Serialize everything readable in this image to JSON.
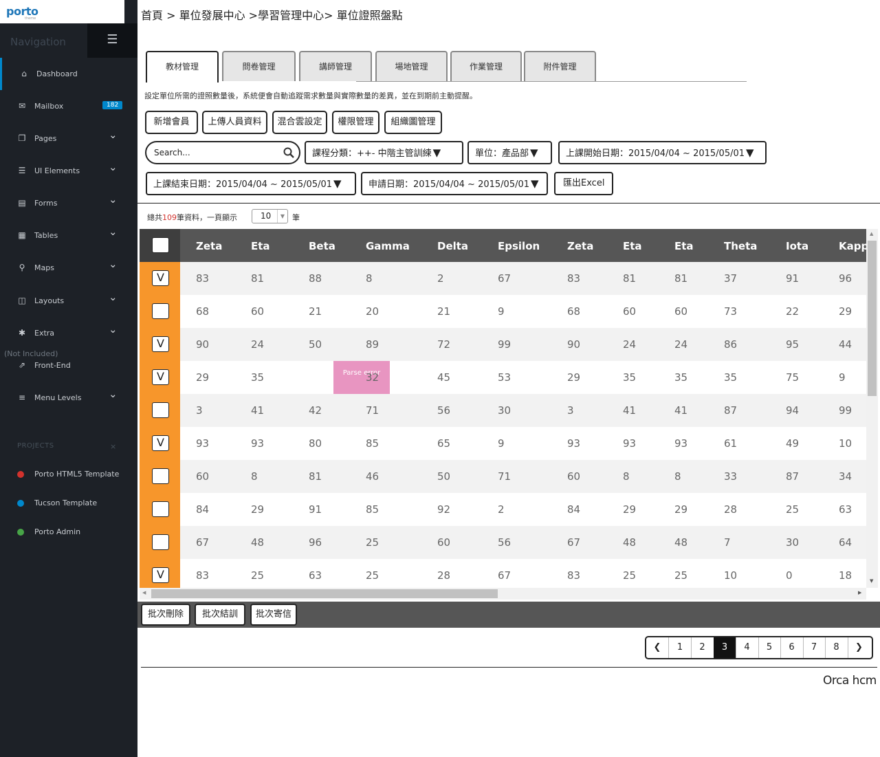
{
  "logo": {
    "text": "porto",
    "sub": "theme"
  },
  "sidebar": {
    "title": "Navigation",
    "toggle_icon": "menu-icon",
    "items": [
      {
        "label": "Dashboard",
        "icon": "home-icon",
        "active": true
      },
      {
        "label": "Mailbox",
        "icon": "envelope-icon",
        "badge": "182"
      },
      {
        "label": "Pages",
        "icon": "copy-icon",
        "expandable": true
      },
      {
        "label": "UI Elements",
        "icon": "tasks-icon",
        "expandable": true
      },
      {
        "label": "Forms",
        "icon": "list-alt-icon",
        "expandable": true
      },
      {
        "label": "Tables",
        "icon": "table-icon",
        "expandable": true
      },
      {
        "label": "Maps",
        "icon": "map-marker-icon",
        "expandable": true
      },
      {
        "label": "Layouts",
        "icon": "columns-icon",
        "expandable": true
      },
      {
        "label": "Extra",
        "icon": "asterisk-icon",
        "expandable": true
      },
      {
        "label": "Front-End",
        "icon": "external-link-icon",
        "note": "(Not Included)"
      },
      {
        "label": "Menu Levels",
        "icon": "align-left-icon",
        "expandable": true
      }
    ],
    "projects_title": "PROJECTS",
    "projects_close": "×",
    "projects": [
      {
        "label": "Porto HTML5 Template",
        "color": "#d2322d"
      },
      {
        "label": "Tucson Template",
        "color": "#0088cc"
      },
      {
        "label": "Porto Admin",
        "color": "#47a447"
      }
    ]
  },
  "breadcrumb": "首頁 > 單位發展中心 >學習管理中心> 單位證照盤點",
  "tabs": [
    "教材管理",
    "問卷管理",
    "講師管理",
    "場地管理",
    "作業管理",
    "附件管理"
  ],
  "description": "設定單位所需的證照數量後，系統便會自動追蹤需求數量與實際數量的差異，並在到期前主動提醒。",
  "actions": [
    "新增會員",
    "上傳人員資料",
    "混合雲設定",
    "權限管理",
    "組織圖管理"
  ],
  "search": {
    "placeholder": "Search..."
  },
  "filters": {
    "category": "課程分類：++- 中階主管訓練",
    "unit": "單位：產品部",
    "start_date": "上課開始日期：2015/04/04 ~ 2015/05/01",
    "end_date": "上課結束日期：2015/04/04 ~ 2015/05/01",
    "apply_date": "申請日期：2015/04/04 ~ 2015/05/01",
    "export": "匯出Excel"
  },
  "count": {
    "prefix": "總共",
    "total": "109",
    "middle": "筆資料，一頁顯示",
    "page_size": "10",
    "unit": "筆"
  },
  "table": {
    "columns": [
      "Zeta",
      "Eta",
      "Beta",
      "Gamma",
      "Delta",
      "Epsilon",
      "Zeta",
      "Eta",
      "Eta",
      "Theta",
      "Iota",
      "Kappa"
    ],
    "rows": [
      {
        "checked": "V",
        "cells": [
          "83",
          "81",
          "88",
          "8",
          "2",
          "67",
          "83",
          "81",
          "81",
          "37",
          "91",
          "96"
        ]
      },
      {
        "checked": "",
        "cells": [
          "68",
          "60",
          "21",
          "20",
          "21",
          "9",
          "68",
          "60",
          "60",
          "73",
          "22",
          "29"
        ]
      },
      {
        "checked": "V",
        "cells": [
          "90",
          "24",
          "50",
          "89",
          "72",
          "99",
          "90",
          "24",
          "24",
          "86",
          "95",
          "44"
        ]
      },
      {
        "checked": "V",
        "cells": [
          "29",
          "35",
          "Parse error",
          "32",
          "45",
          "53",
          "29",
          "35",
          "35",
          "35",
          "75",
          "9"
        ]
      },
      {
        "checked": "",
        "cells": [
          "3",
          "41",
          "42",
          "71",
          "56",
          "30",
          "3",
          "41",
          "41",
          "87",
          "94",
          "99"
        ]
      },
      {
        "checked": "V",
        "cells": [
          "93",
          "93",
          "80",
          "85",
          "65",
          "9",
          "93",
          "93",
          "93",
          "61",
          "49",
          "10"
        ]
      },
      {
        "checked": "",
        "cells": [
          "60",
          "8",
          "81",
          "46",
          "50",
          "71",
          "60",
          "8",
          "8",
          "33",
          "87",
          "34"
        ]
      },
      {
        "checked": "",
        "cells": [
          "84",
          "29",
          "91",
          "85",
          "92",
          "2",
          "84",
          "29",
          "29",
          "28",
          "25",
          "63"
        ]
      },
      {
        "checked": "",
        "cells": [
          "67",
          "48",
          "96",
          "25",
          "60",
          "56",
          "67",
          "48",
          "48",
          "7",
          "30",
          "64"
        ]
      },
      {
        "checked": "V",
        "cells": [
          "83",
          "25",
          "63",
          "25",
          "28",
          "67",
          "83",
          "25",
          "25",
          "10",
          "0",
          "18"
        ]
      }
    ]
  },
  "batch": [
    "批次刪除",
    "批次結訓",
    "批次寄信"
  ],
  "pagination": {
    "prev": "❮",
    "next": "❯",
    "pages": [
      "1",
      "2",
      "3",
      "4",
      "5",
      "6",
      "7",
      "8"
    ],
    "current": "3"
  },
  "footer": "Orca hcm",
  "colors": {
    "accent": "#0088cc",
    "select_column": "#f7962b",
    "header": "#565656",
    "error_cell": "#e895c1"
  }
}
